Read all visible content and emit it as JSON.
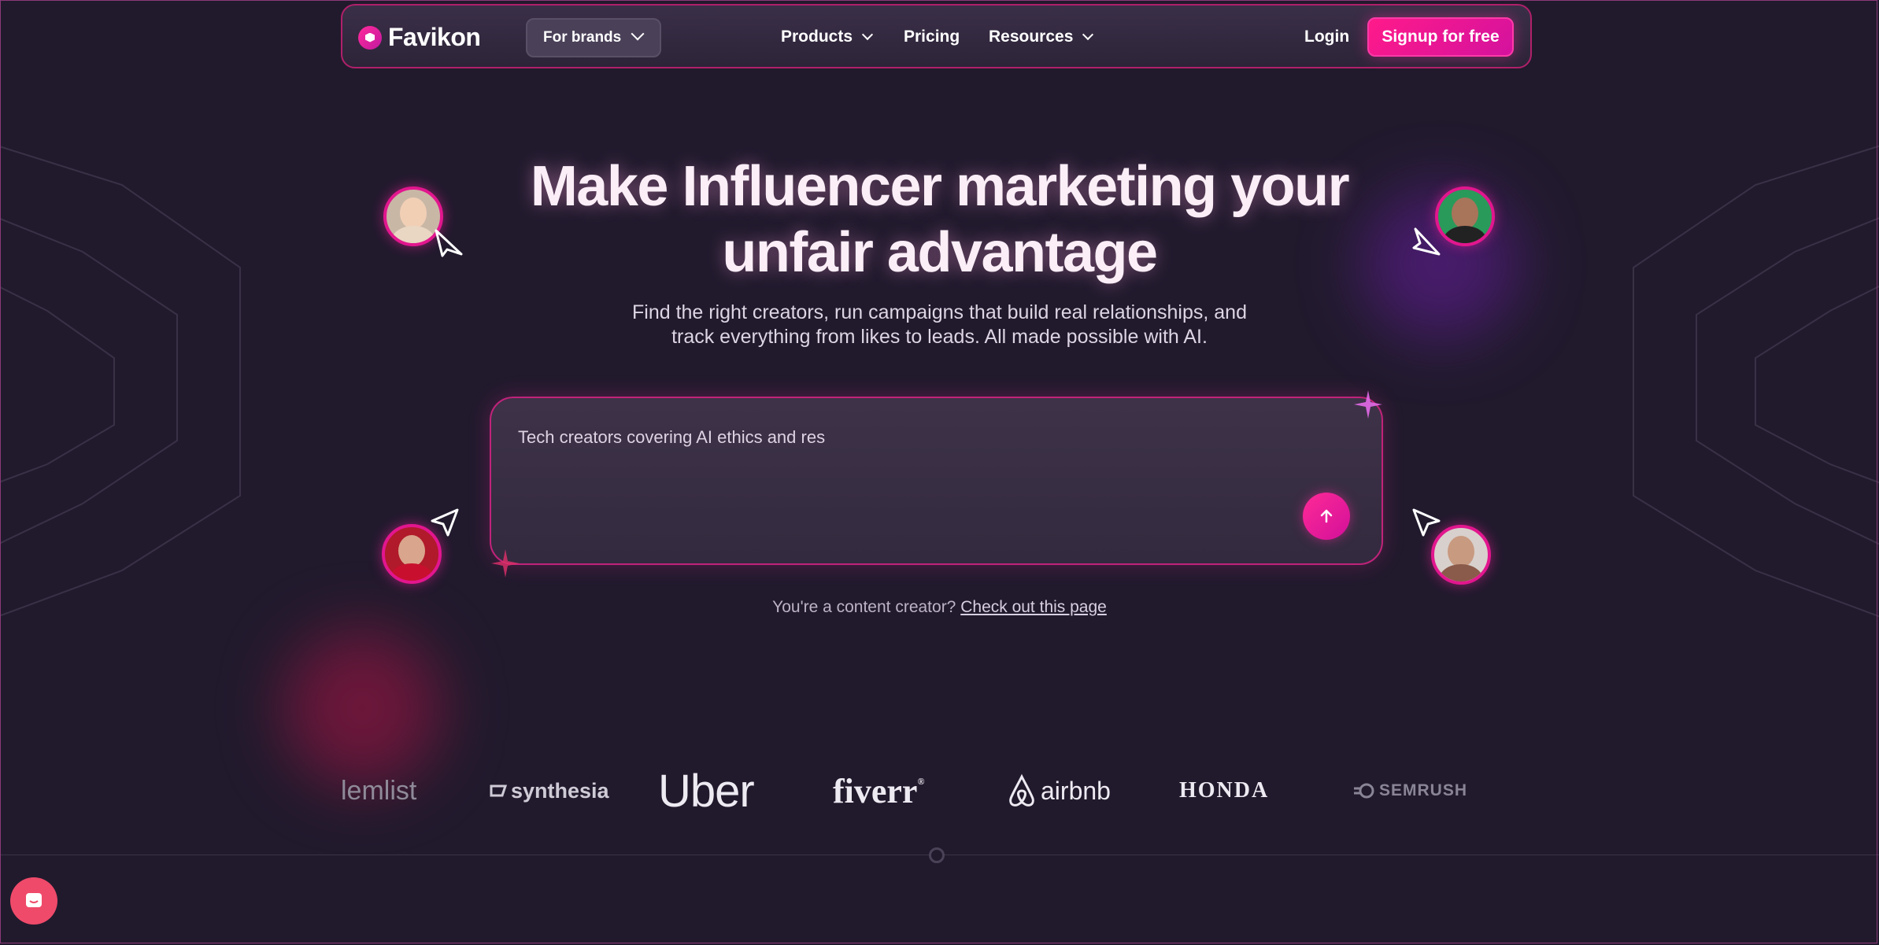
{
  "nav": {
    "logo_text": "Favikon",
    "brand_select": "For brands",
    "products": "Products",
    "pricing": "Pricing",
    "resources": "Resources",
    "login": "Login",
    "signup": "Signup for free"
  },
  "hero": {
    "title_line1": "Make Influencer marketing your",
    "title_line2": "unfair advantage",
    "subtitle_line1": "Find the right creators, run campaigns that build real relationships, and",
    "subtitle_line2": "track everything from likes to leads. All made possible with AI."
  },
  "search": {
    "value": "Tech creators covering AI ethics and res",
    "send_icon": "arrow-up-icon"
  },
  "creator_prompt": {
    "text": "You're a content creator?",
    "link": "Check out this page"
  },
  "logos": [
    "lemlist",
    "synthesia",
    "Uber",
    "fiverr",
    "airbnb",
    "HONDA",
    "SEMRUSH"
  ],
  "colors": {
    "background": "#211a2d",
    "accent": "#ff1a8a",
    "accent_border": "#c0237a"
  }
}
